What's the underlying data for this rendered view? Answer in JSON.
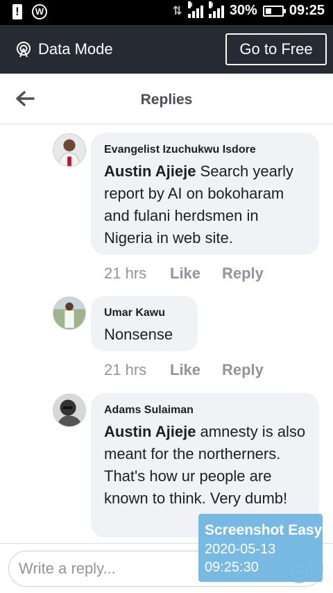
{
  "status_bar": {
    "battery": "30%",
    "time": "09:25",
    "network_label": "H"
  },
  "data_mode": {
    "label": "Data Mode",
    "button": "Go to Free"
  },
  "header": {
    "title": "Replies"
  },
  "comments": [
    {
      "author": "Evangelist Izuchukwu Isdore",
      "mention": "Austin Ajieje",
      "text": "  Search yearly report by AI on bokoharam and fulani herdsmen in Nigeria in web site.",
      "time": "21 hrs",
      "like": "Like",
      "reply": "Reply"
    },
    {
      "author": "Umar Kawu",
      "mention": "",
      "text": "Nonsense",
      "time": "21 hrs",
      "like": "Like",
      "reply": "Reply"
    },
    {
      "author": "Adams Sulaiman",
      "mention": "Austin Ajieje",
      "text": " amnesty is also meant for the northerners. That's how ur people are known to think. Very dumb!"
    }
  ],
  "reply_box": {
    "placeholder": "Write a reply..."
  },
  "watermark": {
    "title": "Screenshot Easy",
    "date": "2020-05-13",
    "time": "09:25:30"
  },
  "colors": {
    "data_bar": "#252a33",
    "bubble": "#f1f2f6",
    "meta_text": "#90949c",
    "watermark": "#6eb4e1"
  },
  "icons": [
    "alert-icon",
    "wordpress-icon",
    "signal-icon",
    "battery-icon",
    "data-mode-icon",
    "back-arrow-icon",
    "smile-icon"
  ]
}
